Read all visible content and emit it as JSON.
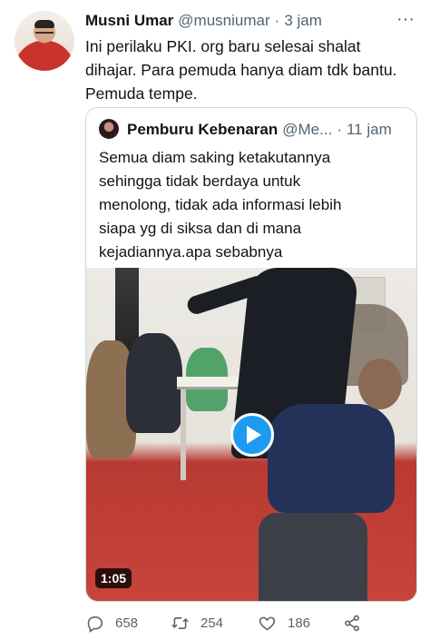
{
  "tweet": {
    "author_name": "Musni Umar",
    "author_handle": "@musniumar",
    "separator": "·",
    "time": "3 jam",
    "text_lines": [
      "Ini perilaku PKI. org baru selesai shalat",
      "dihajar. Para pemuda hanya diam tdk bantu.",
      "Pemuda tempe."
    ]
  },
  "quote": {
    "author_name": "Pemburu Kebenaran",
    "author_handle": "@Me...",
    "separator": "·",
    "time": "11 jam",
    "text_lines": [
      "Semua diam saking ketakutannya",
      "sehingga tidak berdaya untuk",
      "menolong, tidak ada informasi lebih",
      "siapa yg di siksa dan di mana",
      "kejadiannya.apa sebabnya"
    ],
    "video": {
      "duration": "1:05",
      "play_icon": "play-icon"
    }
  },
  "actions": {
    "reply_count": "658",
    "retweet_count": "254",
    "like_count": "186",
    "icons": [
      "reply-icon",
      "retweet-icon",
      "like-icon",
      "share-icon"
    ]
  },
  "colors": {
    "accent": "#1d9bf0",
    "secondary_text": "#536471",
    "border": "#cfd9de"
  }
}
